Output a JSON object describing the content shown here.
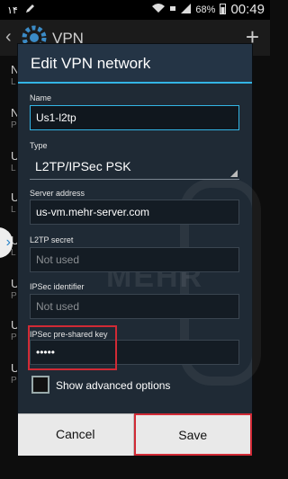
{
  "status_bar": {
    "left_text": "۱۴",
    "battery_percent": "68%",
    "time": "00:49"
  },
  "background_screen": {
    "title": "VPN",
    "list_items": [
      {
        "letter": "N",
        "sub": "L"
      },
      {
        "letter": "N",
        "sub": "P"
      },
      {
        "letter": "U",
        "sub": "L"
      },
      {
        "letter": "U",
        "sub": "L"
      },
      {
        "letter": "U",
        "sub": "L"
      },
      {
        "letter": "U",
        "sub": "P"
      },
      {
        "letter": "U",
        "sub": "P"
      },
      {
        "letter": "U",
        "sub": "P"
      }
    ]
  },
  "dialog": {
    "title": "Edit VPN network",
    "name_label": "Name",
    "name_value": "Us1-l2tp",
    "type_label": "Type",
    "type_value": "L2TP/IPSec PSK",
    "server_label": "Server address",
    "server_value": "us-vm.mehr-server.com",
    "l2tp_secret_label": "L2TP secret",
    "l2tp_secret_placeholder": "Not used",
    "ipsec_id_label": "IPSec identifier",
    "ipsec_id_placeholder": "Not used",
    "psk_label": "IPSec pre-shared key",
    "psk_value": "•••••",
    "advanced_label": "Show advanced options",
    "cancel_label": "Cancel",
    "save_label": "Save"
  },
  "watermark": "MEHR",
  "colors": {
    "accent": "#33b5e5",
    "highlight": "#d12a35",
    "dialog_bg": "#1f2a35"
  }
}
